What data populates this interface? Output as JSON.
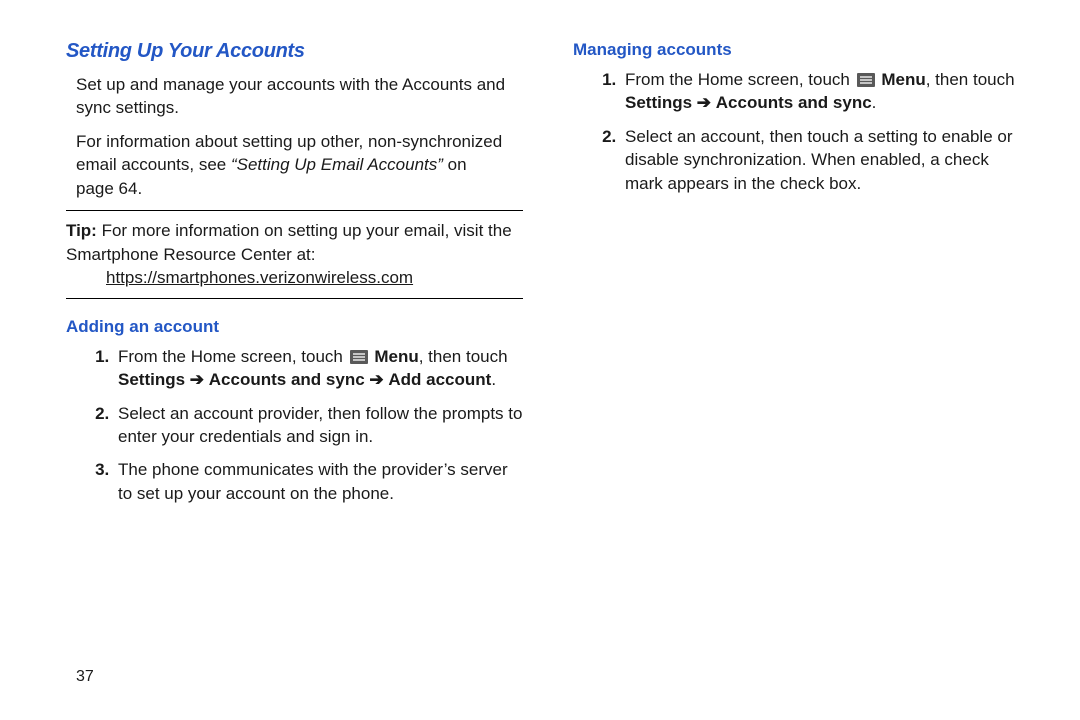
{
  "left": {
    "title": "Setting Up Your Accounts",
    "para1": "Set up and manage your accounts with the Accounts and sync settings.",
    "para2_a": "For information about setting up other, non-synchronized email accounts, see ",
    "para2_ref": "“Setting Up Email Accounts”",
    "para2_b": " on page 64.",
    "tip_label": "Tip:",
    "tip_text": " For more information on setting up your email, visit the Smartphone Resource Center at:",
    "tip_link": "https://smartphones.verizonwireless.com",
    "sub_heading": "Adding an account",
    "step1_a": "From the Home screen, touch ",
    "step1_menu": "Menu",
    "step1_b": ", then touch ",
    "step1_path1": "Settings",
    "step1_path2": "Accounts and sync",
    "step1_path3": "Add account",
    "step1_end": ".",
    "step2": "Select an account provider, then follow the prompts to enter your credentials and sign in.",
    "step3": "The phone communicates with the provider’s server to set up your account on the phone."
  },
  "right": {
    "sub_heading": "Managing accounts",
    "step1_a": "From the Home screen, touch ",
    "step1_menu": "Menu",
    "step1_b": ", then touch ",
    "step1_path1": "Settings",
    "step1_path2": "Accounts and sync",
    "step1_end": ".",
    "step2": "Select an account, then touch a setting to enable or disable synchronization. When enabled, a check mark appears in the check box."
  },
  "arrow": "➔",
  "page_number": "37"
}
